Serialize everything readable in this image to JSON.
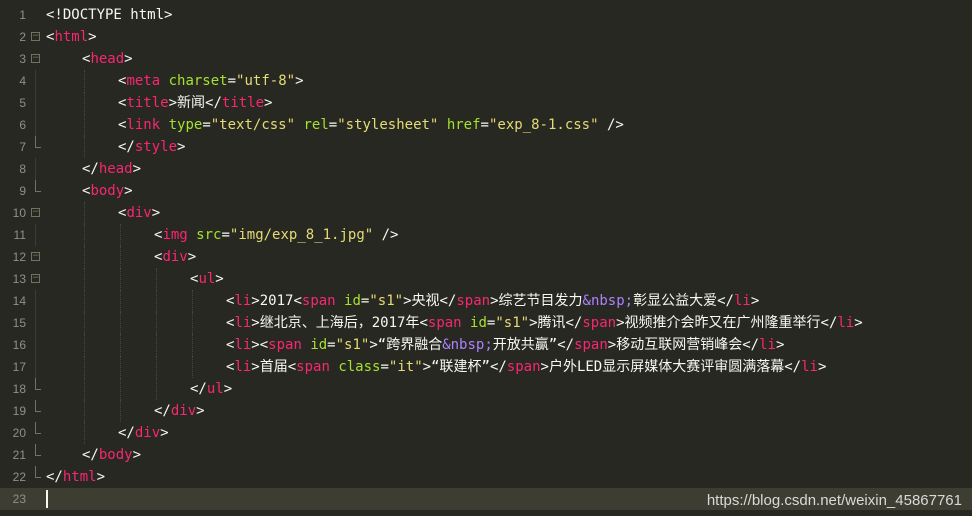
{
  "editor": {
    "theme_colors": {
      "background": "#272822",
      "tag": "#f92672",
      "attribute": "#a6e22e",
      "string": "#e6db74",
      "entity": "#ae81ff",
      "text": "#f8f8f2",
      "line_number": "#8f908a"
    },
    "watermark": "https://blog.csdn.net/weixin_45867761",
    "lines": [
      {
        "n": "1",
        "indent": 0,
        "fold": "",
        "tokens": [
          [
            "punc",
            "<!DOCTYPE html>"
          ]
        ]
      },
      {
        "n": "2",
        "indent": 0,
        "fold": "open",
        "tokens": [
          [
            "punc",
            "<"
          ],
          [
            "tag",
            "html"
          ],
          [
            "punc",
            ">"
          ]
        ]
      },
      {
        "n": "3",
        "indent": 1,
        "fold": "open",
        "tokens": [
          [
            "punc",
            "<"
          ],
          [
            "tag",
            "head"
          ],
          [
            "punc",
            ">"
          ]
        ]
      },
      {
        "n": "4",
        "indent": 2,
        "fold": "mid",
        "tokens": [
          [
            "punc",
            "<"
          ],
          [
            "tag",
            "meta"
          ],
          [
            "punc",
            " "
          ],
          [
            "attr",
            "charset"
          ],
          [
            "punc",
            "="
          ],
          [
            "str",
            "\"utf-8\""
          ],
          [
            "punc",
            ">"
          ]
        ]
      },
      {
        "n": "5",
        "indent": 2,
        "fold": "mid",
        "tokens": [
          [
            "punc",
            "<"
          ],
          [
            "tag",
            "title"
          ],
          [
            "punc",
            ">"
          ],
          [
            "text",
            "新闻"
          ],
          [
            "punc",
            "</"
          ],
          [
            "tag",
            "title"
          ],
          [
            "punc",
            ">"
          ]
        ]
      },
      {
        "n": "6",
        "indent": 2,
        "fold": "mid",
        "tokens": [
          [
            "punc",
            "<"
          ],
          [
            "tag",
            "link"
          ],
          [
            "punc",
            " "
          ],
          [
            "attr",
            "type"
          ],
          [
            "punc",
            "="
          ],
          [
            "str",
            "\"text/css\""
          ],
          [
            "punc",
            " "
          ],
          [
            "attr",
            "rel"
          ],
          [
            "punc",
            "="
          ],
          [
            "str",
            "\"stylesheet\""
          ],
          [
            "punc",
            " "
          ],
          [
            "attr",
            "href"
          ],
          [
            "punc",
            "="
          ],
          [
            "str",
            "\"exp_8-1.css\""
          ],
          [
            "punc",
            " />"
          ]
        ]
      },
      {
        "n": "7",
        "indent": 2,
        "fold": "end",
        "tokens": [
          [
            "punc",
            "</"
          ],
          [
            "tag",
            "style"
          ],
          [
            "punc",
            ">"
          ]
        ]
      },
      {
        "n": "8",
        "indent": 1,
        "fold": "mid",
        "tokens": [
          [
            "punc",
            "</"
          ],
          [
            "tag",
            "head"
          ],
          [
            "punc",
            ">"
          ]
        ]
      },
      {
        "n": "9",
        "indent": 1,
        "fold": "end",
        "tokens": [
          [
            "punc",
            "<"
          ],
          [
            "tag",
            "body"
          ],
          [
            "punc",
            ">"
          ]
        ]
      },
      {
        "n": "10",
        "indent": 2,
        "fold": "open",
        "tokens": [
          [
            "punc",
            "<"
          ],
          [
            "tag",
            "div"
          ],
          [
            "punc",
            ">"
          ]
        ]
      },
      {
        "n": "11",
        "indent": 3,
        "fold": "mid",
        "tokens": [
          [
            "punc",
            "<"
          ],
          [
            "tag",
            "img"
          ],
          [
            "punc",
            " "
          ],
          [
            "attr",
            "src"
          ],
          [
            "punc",
            "="
          ],
          [
            "str",
            "\"img/exp_8_1.jpg\""
          ],
          [
            "punc",
            " />"
          ]
        ]
      },
      {
        "n": "12",
        "indent": 3,
        "fold": "open",
        "tokens": [
          [
            "punc",
            "<"
          ],
          [
            "tag",
            "div"
          ],
          [
            "punc",
            ">"
          ]
        ]
      },
      {
        "n": "13",
        "indent": 4,
        "fold": "open",
        "tokens": [
          [
            "punc",
            "<"
          ],
          [
            "tag",
            "ul"
          ],
          [
            "punc",
            ">"
          ]
        ]
      },
      {
        "n": "14",
        "indent": 5,
        "fold": "mid",
        "tokens": [
          [
            "punc",
            "<"
          ],
          [
            "tag",
            "li"
          ],
          [
            "punc",
            ">"
          ],
          [
            "text",
            "2017"
          ],
          [
            "punc",
            "<"
          ],
          [
            "tag",
            "span"
          ],
          [
            "punc",
            " "
          ],
          [
            "attr",
            "id"
          ],
          [
            "punc",
            "="
          ],
          [
            "str",
            "\"s1\""
          ],
          [
            "punc",
            ">"
          ],
          [
            "text",
            "央视"
          ],
          [
            "punc",
            "</"
          ],
          [
            "tag",
            "span"
          ],
          [
            "punc",
            ">"
          ],
          [
            "text",
            "综艺节目发力"
          ],
          [
            "ent",
            "&nbsp;"
          ],
          [
            "text",
            "彰显公益大爱"
          ],
          [
            "punc",
            "</"
          ],
          [
            "tag",
            "li"
          ],
          [
            "punc",
            ">"
          ]
        ]
      },
      {
        "n": "15",
        "indent": 5,
        "fold": "mid",
        "tokens": [
          [
            "punc",
            "<"
          ],
          [
            "tag",
            "li"
          ],
          [
            "punc",
            ">"
          ],
          [
            "text",
            "继北京、上海后，2017年"
          ],
          [
            "punc",
            "<"
          ],
          [
            "tag",
            "span"
          ],
          [
            "punc",
            " "
          ],
          [
            "attr",
            "id"
          ],
          [
            "punc",
            "="
          ],
          [
            "str",
            "\"s1\""
          ],
          [
            "punc",
            ">"
          ],
          [
            "text",
            "腾讯"
          ],
          [
            "punc",
            "</"
          ],
          [
            "tag",
            "span"
          ],
          [
            "punc",
            ">"
          ],
          [
            "text",
            "视频推介会昨又在广州隆重举行"
          ],
          [
            "punc",
            "</"
          ],
          [
            "tag",
            "li"
          ],
          [
            "punc",
            ">"
          ]
        ]
      },
      {
        "n": "16",
        "indent": 5,
        "fold": "mid",
        "tokens": [
          [
            "punc",
            "<"
          ],
          [
            "tag",
            "li"
          ],
          [
            "punc",
            "><"
          ],
          [
            "tag",
            "span"
          ],
          [
            "punc",
            " "
          ],
          [
            "attr",
            "id"
          ],
          [
            "punc",
            "="
          ],
          [
            "str",
            "\"s1\""
          ],
          [
            "punc",
            ">"
          ],
          [
            "text",
            "“跨界融合"
          ],
          [
            "ent",
            "&nbsp;"
          ],
          [
            "text",
            "开放共赢”"
          ],
          [
            "punc",
            "</"
          ],
          [
            "tag",
            "span"
          ],
          [
            "punc",
            ">"
          ],
          [
            "text",
            "移动互联网营销峰会"
          ],
          [
            "punc",
            "</"
          ],
          [
            "tag",
            "li"
          ],
          [
            "punc",
            ">"
          ]
        ]
      },
      {
        "n": "17",
        "indent": 5,
        "fold": "mid",
        "tokens": [
          [
            "punc",
            "<"
          ],
          [
            "tag",
            "li"
          ],
          [
            "punc",
            ">"
          ],
          [
            "text",
            "首届"
          ],
          [
            "punc",
            "<"
          ],
          [
            "tag",
            "span"
          ],
          [
            "punc",
            " "
          ],
          [
            "attr",
            "class"
          ],
          [
            "punc",
            "="
          ],
          [
            "str",
            "\"it\""
          ],
          [
            "punc",
            ">"
          ],
          [
            "text",
            "“联建杯”"
          ],
          [
            "punc",
            "</"
          ],
          [
            "tag",
            "span"
          ],
          [
            "punc",
            ">"
          ],
          [
            "text",
            "户外LED显示屏媒体大赛评审圆满落幕"
          ],
          [
            "punc",
            "</"
          ],
          [
            "tag",
            "li"
          ],
          [
            "punc",
            ">"
          ]
        ]
      },
      {
        "n": "18",
        "indent": 4,
        "fold": "end",
        "tokens": [
          [
            "punc",
            "</"
          ],
          [
            "tag",
            "ul"
          ],
          [
            "punc",
            ">"
          ]
        ]
      },
      {
        "n": "19",
        "indent": 3,
        "fold": "end",
        "tokens": [
          [
            "punc",
            "</"
          ],
          [
            "tag",
            "div"
          ],
          [
            "punc",
            ">"
          ]
        ]
      },
      {
        "n": "20",
        "indent": 2,
        "fold": "end",
        "tokens": [
          [
            "punc",
            "</"
          ],
          [
            "tag",
            "div"
          ],
          [
            "punc",
            ">"
          ]
        ]
      },
      {
        "n": "21",
        "indent": 1,
        "fold": "end",
        "tokens": [
          [
            "punc",
            "</"
          ],
          [
            "tag",
            "body"
          ],
          [
            "punc",
            ">"
          ]
        ]
      },
      {
        "n": "22",
        "indent": 0,
        "fold": "end",
        "tokens": [
          [
            "punc",
            "</"
          ],
          [
            "tag",
            "html"
          ],
          [
            "punc",
            ">"
          ]
        ]
      },
      {
        "n": "23",
        "indent": 0,
        "fold": "",
        "tokens": [],
        "current": true
      }
    ]
  }
}
